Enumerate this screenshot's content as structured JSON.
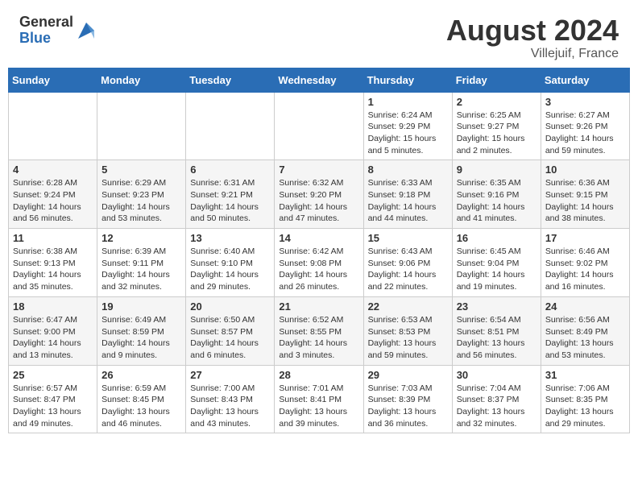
{
  "header": {
    "logo_general": "General",
    "logo_blue": "Blue",
    "month_title": "August 2024",
    "location": "Villejuif, France"
  },
  "days_of_week": [
    "Sunday",
    "Monday",
    "Tuesday",
    "Wednesday",
    "Thursday",
    "Friday",
    "Saturday"
  ],
  "weeks": [
    [
      {
        "day": "",
        "info": ""
      },
      {
        "day": "",
        "info": ""
      },
      {
        "day": "",
        "info": ""
      },
      {
        "day": "",
        "info": ""
      },
      {
        "day": "1",
        "sunrise": "Sunrise: 6:24 AM",
        "sunset": "Sunset: 9:29 PM",
        "daylight": "Daylight: 15 hours and 5 minutes."
      },
      {
        "day": "2",
        "sunrise": "Sunrise: 6:25 AM",
        "sunset": "Sunset: 9:27 PM",
        "daylight": "Daylight: 15 hours and 2 minutes."
      },
      {
        "day": "3",
        "sunrise": "Sunrise: 6:27 AM",
        "sunset": "Sunset: 9:26 PM",
        "daylight": "Daylight: 14 hours and 59 minutes."
      }
    ],
    [
      {
        "day": "4",
        "sunrise": "Sunrise: 6:28 AM",
        "sunset": "Sunset: 9:24 PM",
        "daylight": "Daylight: 14 hours and 56 minutes."
      },
      {
        "day": "5",
        "sunrise": "Sunrise: 6:29 AM",
        "sunset": "Sunset: 9:23 PM",
        "daylight": "Daylight: 14 hours and 53 minutes."
      },
      {
        "day": "6",
        "sunrise": "Sunrise: 6:31 AM",
        "sunset": "Sunset: 9:21 PM",
        "daylight": "Daylight: 14 hours and 50 minutes."
      },
      {
        "day": "7",
        "sunrise": "Sunrise: 6:32 AM",
        "sunset": "Sunset: 9:20 PM",
        "daylight": "Daylight: 14 hours and 47 minutes."
      },
      {
        "day": "8",
        "sunrise": "Sunrise: 6:33 AM",
        "sunset": "Sunset: 9:18 PM",
        "daylight": "Daylight: 14 hours and 44 minutes."
      },
      {
        "day": "9",
        "sunrise": "Sunrise: 6:35 AM",
        "sunset": "Sunset: 9:16 PM",
        "daylight": "Daylight: 14 hours and 41 minutes."
      },
      {
        "day": "10",
        "sunrise": "Sunrise: 6:36 AM",
        "sunset": "Sunset: 9:15 PM",
        "daylight": "Daylight: 14 hours and 38 minutes."
      }
    ],
    [
      {
        "day": "11",
        "sunrise": "Sunrise: 6:38 AM",
        "sunset": "Sunset: 9:13 PM",
        "daylight": "Daylight: 14 hours and 35 minutes."
      },
      {
        "day": "12",
        "sunrise": "Sunrise: 6:39 AM",
        "sunset": "Sunset: 9:11 PM",
        "daylight": "Daylight: 14 hours and 32 minutes."
      },
      {
        "day": "13",
        "sunrise": "Sunrise: 6:40 AM",
        "sunset": "Sunset: 9:10 PM",
        "daylight": "Daylight: 14 hours and 29 minutes."
      },
      {
        "day": "14",
        "sunrise": "Sunrise: 6:42 AM",
        "sunset": "Sunset: 9:08 PM",
        "daylight": "Daylight: 14 hours and 26 minutes."
      },
      {
        "day": "15",
        "sunrise": "Sunrise: 6:43 AM",
        "sunset": "Sunset: 9:06 PM",
        "daylight": "Daylight: 14 hours and 22 minutes."
      },
      {
        "day": "16",
        "sunrise": "Sunrise: 6:45 AM",
        "sunset": "Sunset: 9:04 PM",
        "daylight": "Daylight: 14 hours and 19 minutes."
      },
      {
        "day": "17",
        "sunrise": "Sunrise: 6:46 AM",
        "sunset": "Sunset: 9:02 PM",
        "daylight": "Daylight: 14 hours and 16 minutes."
      }
    ],
    [
      {
        "day": "18",
        "sunrise": "Sunrise: 6:47 AM",
        "sunset": "Sunset: 9:00 PM",
        "daylight": "Daylight: 14 hours and 13 minutes."
      },
      {
        "day": "19",
        "sunrise": "Sunrise: 6:49 AM",
        "sunset": "Sunset: 8:59 PM",
        "daylight": "Daylight: 14 hours and 9 minutes."
      },
      {
        "day": "20",
        "sunrise": "Sunrise: 6:50 AM",
        "sunset": "Sunset: 8:57 PM",
        "daylight": "Daylight: 14 hours and 6 minutes."
      },
      {
        "day": "21",
        "sunrise": "Sunrise: 6:52 AM",
        "sunset": "Sunset: 8:55 PM",
        "daylight": "Daylight: 14 hours and 3 minutes."
      },
      {
        "day": "22",
        "sunrise": "Sunrise: 6:53 AM",
        "sunset": "Sunset: 8:53 PM",
        "daylight": "Daylight: 13 hours and 59 minutes."
      },
      {
        "day": "23",
        "sunrise": "Sunrise: 6:54 AM",
        "sunset": "Sunset: 8:51 PM",
        "daylight": "Daylight: 13 hours and 56 minutes."
      },
      {
        "day": "24",
        "sunrise": "Sunrise: 6:56 AM",
        "sunset": "Sunset: 8:49 PM",
        "daylight": "Daylight: 13 hours and 53 minutes."
      }
    ],
    [
      {
        "day": "25",
        "sunrise": "Sunrise: 6:57 AM",
        "sunset": "Sunset: 8:47 PM",
        "daylight": "Daylight: 13 hours and 49 minutes."
      },
      {
        "day": "26",
        "sunrise": "Sunrise: 6:59 AM",
        "sunset": "Sunset: 8:45 PM",
        "daylight": "Daylight: 13 hours and 46 minutes."
      },
      {
        "day": "27",
        "sunrise": "Sunrise: 7:00 AM",
        "sunset": "Sunset: 8:43 PM",
        "daylight": "Daylight: 13 hours and 43 minutes."
      },
      {
        "day": "28",
        "sunrise": "Sunrise: 7:01 AM",
        "sunset": "Sunset: 8:41 PM",
        "daylight": "Daylight: 13 hours and 39 minutes."
      },
      {
        "day": "29",
        "sunrise": "Sunrise: 7:03 AM",
        "sunset": "Sunset: 8:39 PM",
        "daylight": "Daylight: 13 hours and 36 minutes."
      },
      {
        "day": "30",
        "sunrise": "Sunrise: 7:04 AM",
        "sunset": "Sunset: 8:37 PM",
        "daylight": "Daylight: 13 hours and 32 minutes."
      },
      {
        "day": "31",
        "sunrise": "Sunrise: 7:06 AM",
        "sunset": "Sunset: 8:35 PM",
        "daylight": "Daylight: 13 hours and 29 minutes."
      }
    ]
  ]
}
